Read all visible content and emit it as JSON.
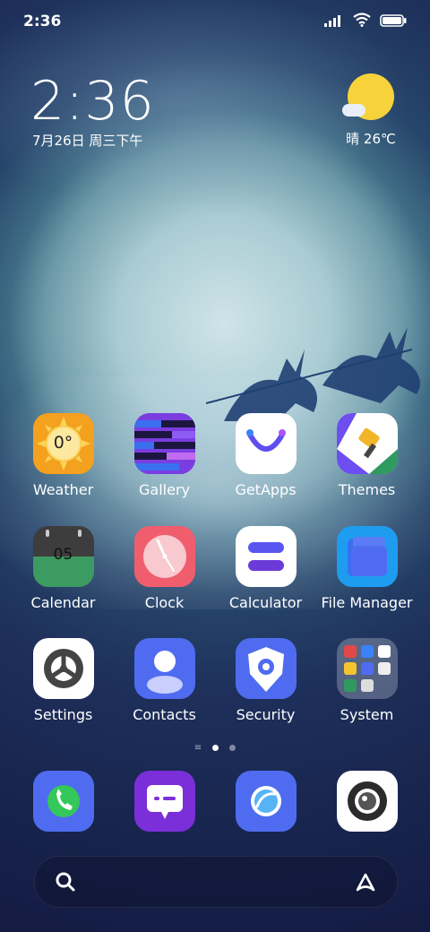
{
  "status_bar": {
    "time": "2:36"
  },
  "lockclock": {
    "time": "2:36",
    "date": "7月26日 周三下午"
  },
  "weather": {
    "text": "晴 26℃"
  },
  "apps": [
    {
      "label": "Weather",
      "icon": "weather-icon",
      "badge": "0°"
    },
    {
      "label": "Gallery",
      "icon": "gallery-icon"
    },
    {
      "label": "GetApps",
      "icon": "getapps-icon"
    },
    {
      "label": "Themes",
      "icon": "themes-icon"
    },
    {
      "label": "Calendar",
      "icon": "calendar-icon",
      "badge": "05"
    },
    {
      "label": "Clock",
      "icon": "clock-icon"
    },
    {
      "label": "Calculator",
      "icon": "calculator-icon"
    },
    {
      "label": "File Manager",
      "icon": "file-manager-icon"
    },
    {
      "label": "Settings",
      "icon": "settings-icon"
    },
    {
      "label": "Contacts",
      "icon": "contacts-icon"
    },
    {
      "label": "Security",
      "icon": "security-icon"
    },
    {
      "label": "System",
      "icon": "system-folder-icon"
    }
  ],
  "dock": [
    {
      "icon": "phone-icon"
    },
    {
      "icon": "messages-icon"
    },
    {
      "icon": "browser-icon"
    },
    {
      "icon": "camera-icon"
    }
  ],
  "pager": {
    "pages": 2,
    "active": 1
  },
  "colors": {
    "accent": "#4f6cf0",
    "weather_bg": "#f4a11f",
    "calendar_top": "#3d3d3d",
    "calendar_bottom": "#3c9b61",
    "clock_bg": "#f05e6e"
  }
}
